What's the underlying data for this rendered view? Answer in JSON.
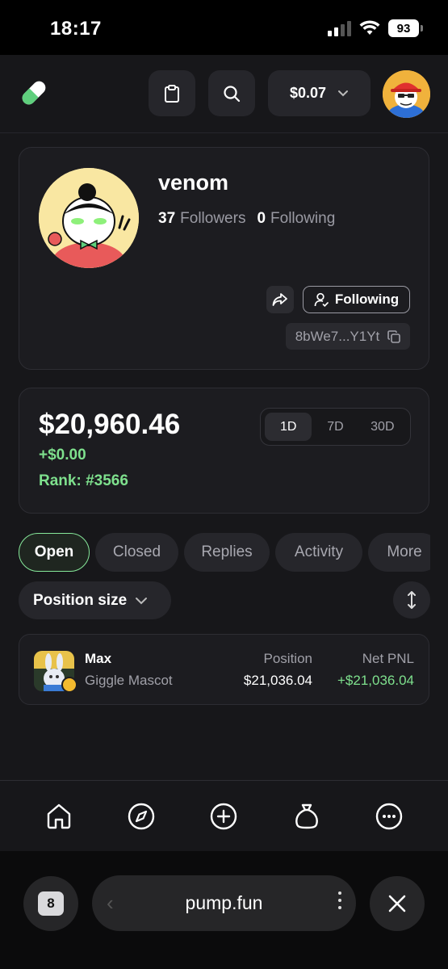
{
  "status_bar": {
    "time": "18:17",
    "battery": "93"
  },
  "header": {
    "balance": "$0.07",
    "icons": [
      "pill-logo-icon",
      "clipboard-icon",
      "search-icon",
      "chevron-down-icon"
    ]
  },
  "profile": {
    "name": "venom",
    "followers_count": "37",
    "followers_label": "Followers",
    "following_count": "0",
    "following_label": "Following",
    "follow_button_label": "Following",
    "address": "8bWe7...Y1Yt"
  },
  "balance": {
    "amount": "$20,960.46",
    "change": "+$0.00",
    "rank": "Rank: #3566",
    "periods": [
      "1D",
      "7D",
      "30D"
    ],
    "active_period": "1D"
  },
  "tabs": [
    "Open",
    "Closed",
    "Replies",
    "Activity",
    "More"
  ],
  "sort": {
    "label": "Position size"
  },
  "positions": [
    {
      "name": "Max",
      "subtitle": "Giggle Mascot",
      "position_label": "Position",
      "position_value": "$21,036.04",
      "pnl_label": "Net PNL",
      "pnl_value": "+$21,036.04"
    }
  ],
  "bottom_nav": [
    "home-icon",
    "compass-icon",
    "plus-circle-icon",
    "money-bag-icon",
    "more-icon"
  ],
  "browser": {
    "tab_count": "8",
    "url": "pump.fun"
  },
  "colors": {
    "accent_green": "#7ee08d",
    "background": "#17171a",
    "card": "#1c1c20"
  }
}
